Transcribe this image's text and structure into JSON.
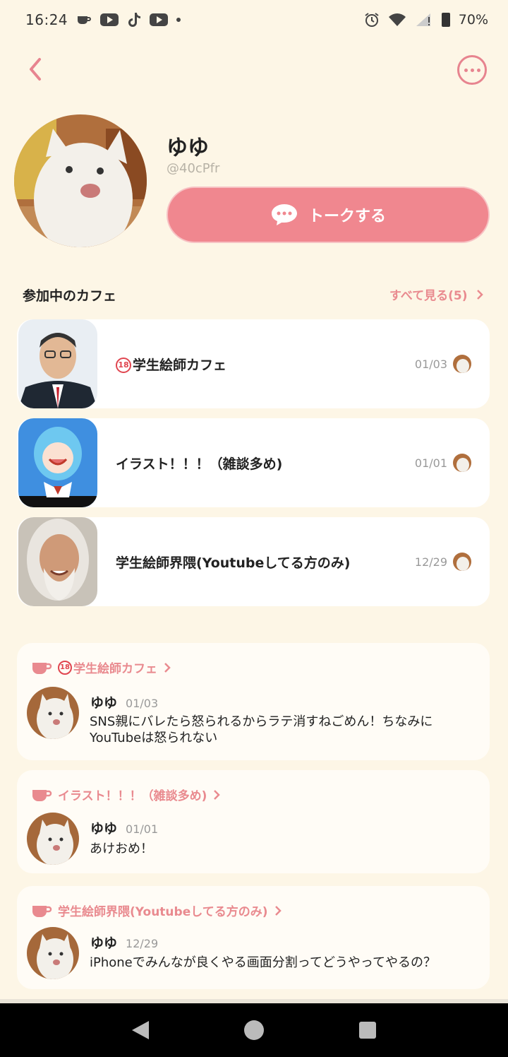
{
  "status_bar": {
    "time": "16:24",
    "battery": "70%",
    "icons": [
      "cafe-icon",
      "youtube-icon",
      "tiktok-icon",
      "youtube-icon",
      "dot-icon",
      "alarm-icon",
      "wifi-icon",
      "signal-icon",
      "battery-icon"
    ]
  },
  "header": {
    "back_icon": "chevron-left-icon",
    "more_icon": "more-icon"
  },
  "profile": {
    "name": "ゆゆ",
    "user_id": "@40cPfr",
    "talk_button_label": "トークする"
  },
  "cafes": {
    "section_title": "参加中のカフェ",
    "see_all_label": "すべて見る(5)",
    "items": [
      {
        "badge": "18",
        "name": "学生絵師カフェ",
        "date": "01/03"
      },
      {
        "badge": "",
        "name": "イラスト！！！（雑談多め)",
        "date": "01/01"
      },
      {
        "badge": "",
        "name": "学生絵師界隈(Youtubeしてる方のみ)",
        "date": "12/29"
      }
    ]
  },
  "posts": [
    {
      "cafe_badge": "18",
      "cafe_name": "学生絵師カフェ",
      "author": "ゆゆ",
      "date": "01/03",
      "text": "SNS親にバレたら怒られるからラテ消すねごめん！ちなみにYouTubeは怒られない"
    },
    {
      "cafe_badge": "",
      "cafe_name": "イラスト！！！（雑談多め)",
      "author": "ゆゆ",
      "date": "01/01",
      "text": "あけおめ！"
    },
    {
      "cafe_badge": "",
      "cafe_name": "学生絵師界隈(Youtubeしてる方のみ)",
      "author": "ゆゆ",
      "date": "12/29",
      "text": "iPhoneでみんなが良くやる画面分割ってどうやってやるの？"
    }
  ],
  "colors": {
    "background": "#fdf6e6",
    "accent": "#f0878f",
    "accent_text": "#e98a8f"
  }
}
